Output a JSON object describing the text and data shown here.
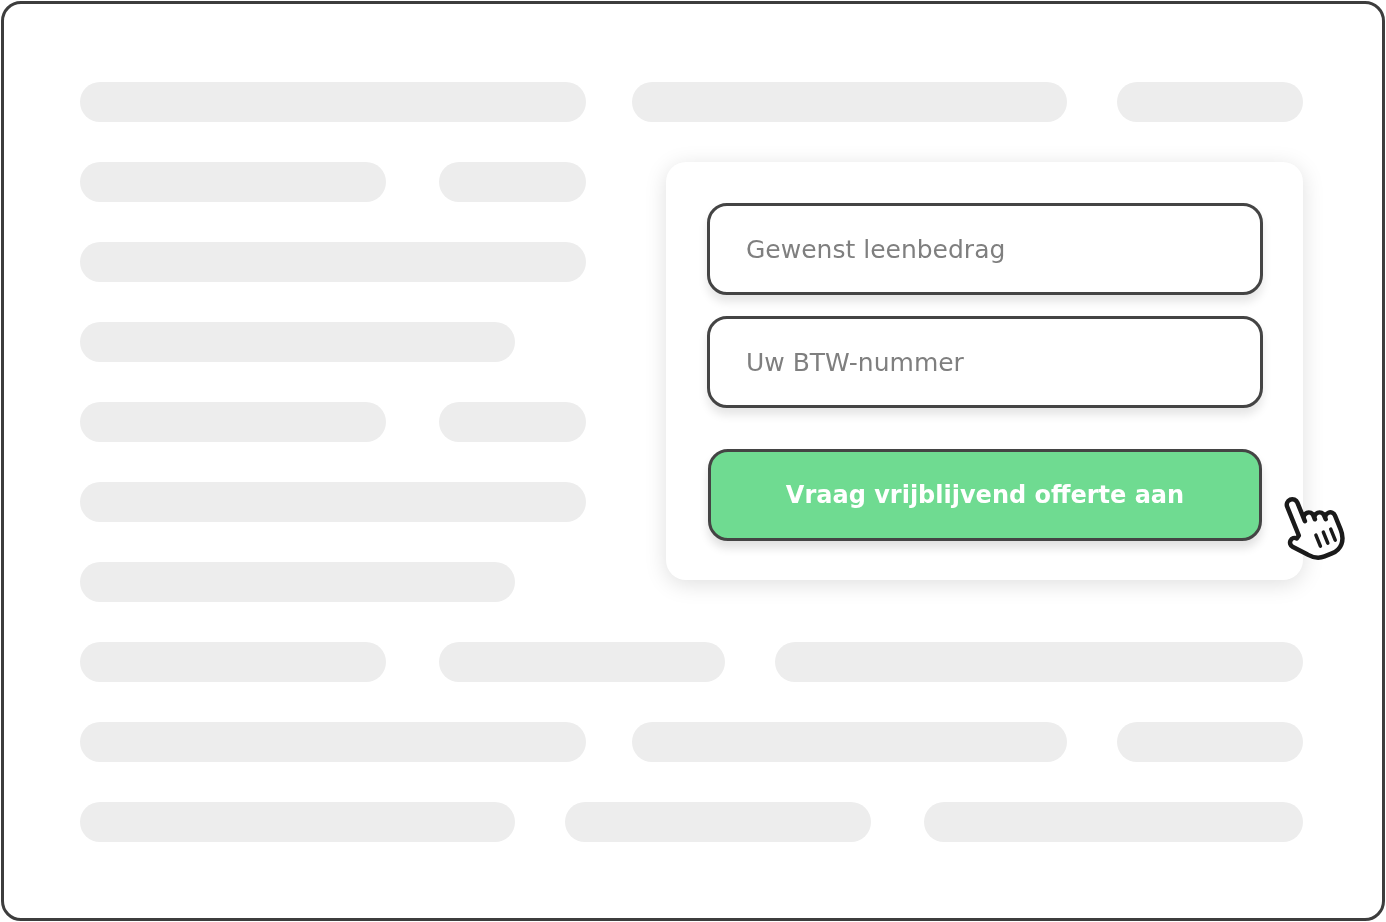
{
  "form": {
    "fields": [
      {
        "placeholder": "Gewenst leenbedrag"
      },
      {
        "placeholder": "Uw BTW-nummer"
      }
    ],
    "submit_button": {
      "label": "Vraag vrijblijvend offerte aan"
    }
  }
}
